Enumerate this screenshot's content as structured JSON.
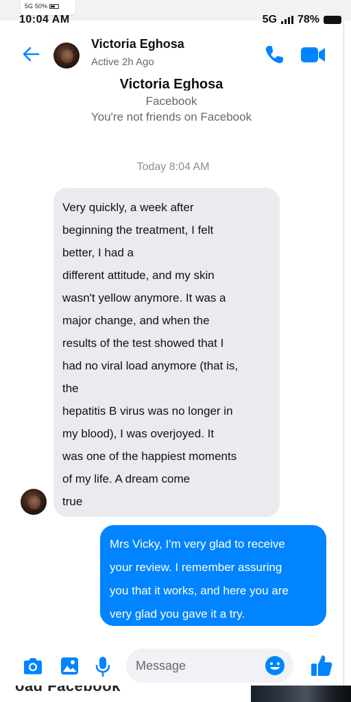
{
  "outer_status": {
    "network": "5G",
    "battery": "50%"
  },
  "status_bar": {
    "time": "10:04 AM",
    "network": "5G",
    "battery": "78%"
  },
  "header": {
    "name": "Victoria Eghosa",
    "status": "Active 2h Ago"
  },
  "intro": {
    "name": "Victoria Eghosa",
    "platform": "Facebook",
    "relationship": "You're not friends on Facebook"
  },
  "timestamp": "Today 8:04 AM",
  "messages": {
    "incoming": {
      "lines": [
        "Very quickly, a week after",
        "beginning the treatment, I felt",
        "better, I had a",
        "different attitude, and my skin",
        "wasn't yellow anymore. It was a",
        "major change, and when the",
        "results of the test showed that I",
        "had no viral load anymore (that is,",
        "the",
        "hepatitis B virus was no longer in",
        "my blood), I was overjoyed. It",
        "was one of the happiest moments",
        "of my life. A dream come",
        "true"
      ]
    },
    "outgoing": {
      "lines": [
        "Mrs Vicky, I'm very glad to receive",
        "your review. I remember assuring",
        "you that it works, and here you are",
        "very glad you gave it a try."
      ]
    }
  },
  "composer": {
    "placeholder": "Message"
  },
  "bottom_strip": {
    "text": "oad Facebook"
  },
  "colors": {
    "accent": "#0084ff",
    "incoming_bubble": "#e9ebef",
    "muted": "#65676b"
  },
  "icons": {
    "back": "arrow-left-icon",
    "call": "phone-icon",
    "video": "video-camera-icon",
    "camera": "camera-icon",
    "gallery": "gallery-icon",
    "mic": "microphone-icon",
    "emoji": "emoji-icon",
    "like": "thumbs-up-icon"
  }
}
